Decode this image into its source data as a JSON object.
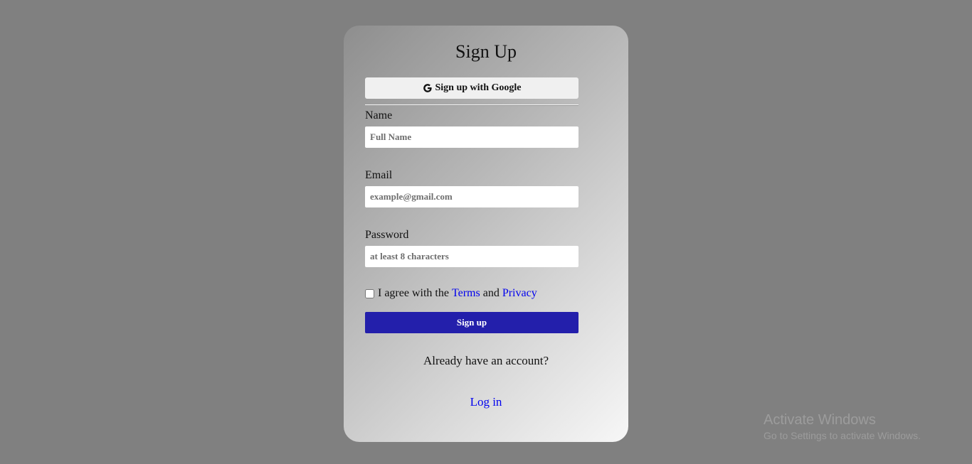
{
  "form": {
    "title": "Sign Up",
    "google_button_label": "Sign up with Google",
    "fields": [
      {
        "label": "Name",
        "placeholder": "Full Name",
        "value": ""
      },
      {
        "label": "Email",
        "placeholder": "example@gmail.com",
        "value": ""
      },
      {
        "label": "Password",
        "placeholder": "at least 8 characters",
        "value": ""
      }
    ],
    "agree": {
      "prefix": "I agree with the",
      "terms_link": "Terms",
      "conjunction": "and",
      "privacy_link": "Privacy",
      "checked": false
    },
    "submit_label": "Sign up",
    "already_text": "Already have an account?",
    "login_link": "Log in"
  },
  "watermark": {
    "title": "Activate Windows",
    "subtitle": "Go to Settings to activate Windows."
  },
  "colors": {
    "page_background": "#808080",
    "submit_button": "#231fab",
    "link": "#0000ee"
  },
  "icons": {
    "google": "google-g-icon"
  }
}
